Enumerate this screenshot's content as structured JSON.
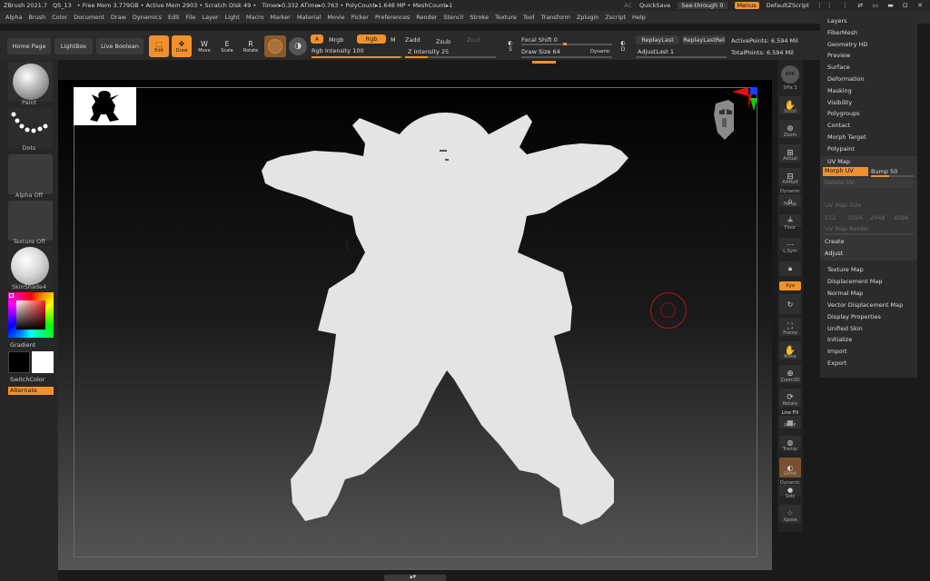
{
  "titlebar": {
    "items": [
      "ZBrush 2021.7",
      "QS_13",
      "• Free Mem 3.779GB • Active Mem 2903 • Scratch Disk 49 •",
      "Timer▸0.332 ATime▸0.763 • PolyCount▸1.648 MP • MeshCount▸1"
    ],
    "ac": "AC",
    "quicksave": "QuickSave",
    "see_through": "See-through  0",
    "menus": "Menus",
    "default_zscript": "DefaultZScript"
  },
  "menubar": [
    "Alpha",
    "Brush",
    "Color",
    "Document",
    "Draw",
    "Dynamics",
    "Edit",
    "File",
    "Layer",
    "Light",
    "Macro",
    "Marker",
    "Material",
    "Movie",
    "Picker",
    "Preferences",
    "Render",
    "Stencil",
    "Stroke",
    "Texture",
    "Tool",
    "Transform",
    "Zplugin",
    "Zscript",
    "Help"
  ],
  "toolbar": {
    "home_page": "Home Page",
    "lightbox": "LightBox",
    "live_boolean": "Live Boolean",
    "edit": "Edit",
    "draw": "Draw",
    "move": "Move",
    "scale": "Scale",
    "rotate": "Rotate",
    "a": "A",
    "mrgb": "Mrgb",
    "rgb": "Rgb",
    "m": "M",
    "zadd": "Zadd",
    "zsub": "Zsub",
    "zcut": "Zcut",
    "rgb_intensity": "Rgb Intensity 100",
    "z_intensity": "Z Intensity 25",
    "focal_shift": "Focal Shift 0",
    "draw_size": "Draw Size 64",
    "dynamic": "Dynamic",
    "replay_last": "ReplayLast",
    "replay_last_rel": "ReplayLastRel",
    "adjust_last": "AdjustLast  1",
    "active_points": "ActivePoints: 6.594 Mil",
    "total_points": "TotalPoints: 6.594 Mil",
    "s": "S",
    "d": "D"
  },
  "leftpanel": {
    "paint": "Paint",
    "dots": "Dots",
    "alpha_off": "Alpha Off",
    "texture_off": "Texture Off",
    "skinshade": "SkinShade4",
    "gradient": "Gradient",
    "switchcolor": "SwitchColor",
    "alternate": "Alternate"
  },
  "rightdock": {
    "bpr": "BPR",
    "spix": "SPix 3",
    "scroll": "Scroll",
    "zoom": "Zoom",
    "actual": "Actual",
    "aahalf": "AAHalf",
    "dynamic": "Dynamic",
    "persp": "Persp",
    "floor": "Floor",
    "lsym": "L.Sym",
    "xyz": "Xyz",
    "frame": "Frame",
    "move": "Move",
    "zoom3d": "Zoom3D",
    "rotate": "Rotate",
    "line_fill": "Line Fill",
    "polyf": "PolyF",
    "transp": "Transp",
    "ghost": "Ghost",
    "dynamic2": "Dynamic",
    "solo": "Solo",
    "xpose": "Xpose"
  },
  "menupanel": {
    "top_items": [
      "Layers",
      "FiberMesh",
      "Geometry HD",
      "Preview",
      "Surface",
      "Deformation",
      "Masking",
      "Visibility",
      "Polygroups",
      "Contact",
      "Morph Target",
      "Polypaint"
    ],
    "uv_map": "UV Map",
    "morph_uv": "Morph UV",
    "bump": "Bump 50",
    "delete_uv": "Delete UV",
    "uv_map_size": "UV Map Size",
    "sizes": [
      "512",
      "1024",
      "2048",
      "4096"
    ],
    "uv_map_border": "UV Map Border",
    "create": "Create",
    "adjust": "Adjust",
    "bottom_items": [
      "Texture Map",
      "Displacement Map",
      "Normal Map",
      "Vector Displacement Map",
      "Display Properties",
      "Unified Skin",
      "Initialize",
      "Import",
      "Export"
    ]
  },
  "colors": {
    "accent": "#f2912b",
    "model": "#e6e6e6",
    "panel": "#2b2b2b"
  }
}
